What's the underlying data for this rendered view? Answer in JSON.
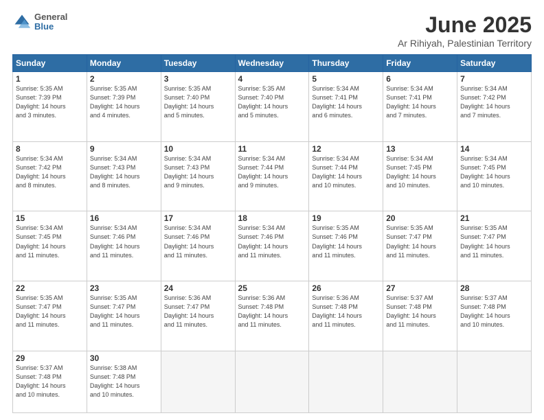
{
  "header": {
    "logo_general": "General",
    "logo_blue": "Blue",
    "title": "June 2025",
    "location": "Ar Rihiyah, Palestinian Territory"
  },
  "weekdays": [
    "Sunday",
    "Monday",
    "Tuesday",
    "Wednesday",
    "Thursday",
    "Friday",
    "Saturday"
  ],
  "weeks": [
    [
      {
        "day": "1",
        "info": "Sunrise: 5:35 AM\nSunset: 7:39 PM\nDaylight: 14 hours\nand 3 minutes."
      },
      {
        "day": "2",
        "info": "Sunrise: 5:35 AM\nSunset: 7:39 PM\nDaylight: 14 hours\nand 4 minutes."
      },
      {
        "day": "3",
        "info": "Sunrise: 5:35 AM\nSunset: 7:40 PM\nDaylight: 14 hours\nand 5 minutes."
      },
      {
        "day": "4",
        "info": "Sunrise: 5:35 AM\nSunset: 7:40 PM\nDaylight: 14 hours\nand 5 minutes."
      },
      {
        "day": "5",
        "info": "Sunrise: 5:34 AM\nSunset: 7:41 PM\nDaylight: 14 hours\nand 6 minutes."
      },
      {
        "day": "6",
        "info": "Sunrise: 5:34 AM\nSunset: 7:41 PM\nDaylight: 14 hours\nand 7 minutes."
      },
      {
        "day": "7",
        "info": "Sunrise: 5:34 AM\nSunset: 7:42 PM\nDaylight: 14 hours\nand 7 minutes."
      }
    ],
    [
      {
        "day": "8",
        "info": "Sunrise: 5:34 AM\nSunset: 7:42 PM\nDaylight: 14 hours\nand 8 minutes."
      },
      {
        "day": "9",
        "info": "Sunrise: 5:34 AM\nSunset: 7:43 PM\nDaylight: 14 hours\nand 8 minutes."
      },
      {
        "day": "10",
        "info": "Sunrise: 5:34 AM\nSunset: 7:43 PM\nDaylight: 14 hours\nand 9 minutes."
      },
      {
        "day": "11",
        "info": "Sunrise: 5:34 AM\nSunset: 7:44 PM\nDaylight: 14 hours\nand 9 minutes."
      },
      {
        "day": "12",
        "info": "Sunrise: 5:34 AM\nSunset: 7:44 PM\nDaylight: 14 hours\nand 10 minutes."
      },
      {
        "day": "13",
        "info": "Sunrise: 5:34 AM\nSunset: 7:45 PM\nDaylight: 14 hours\nand 10 minutes."
      },
      {
        "day": "14",
        "info": "Sunrise: 5:34 AM\nSunset: 7:45 PM\nDaylight: 14 hours\nand 10 minutes."
      }
    ],
    [
      {
        "day": "15",
        "info": "Sunrise: 5:34 AM\nSunset: 7:45 PM\nDaylight: 14 hours\nand 11 minutes."
      },
      {
        "day": "16",
        "info": "Sunrise: 5:34 AM\nSunset: 7:46 PM\nDaylight: 14 hours\nand 11 minutes."
      },
      {
        "day": "17",
        "info": "Sunrise: 5:34 AM\nSunset: 7:46 PM\nDaylight: 14 hours\nand 11 minutes."
      },
      {
        "day": "18",
        "info": "Sunrise: 5:34 AM\nSunset: 7:46 PM\nDaylight: 14 hours\nand 11 minutes."
      },
      {
        "day": "19",
        "info": "Sunrise: 5:35 AM\nSunset: 7:46 PM\nDaylight: 14 hours\nand 11 minutes."
      },
      {
        "day": "20",
        "info": "Sunrise: 5:35 AM\nSunset: 7:47 PM\nDaylight: 14 hours\nand 11 minutes."
      },
      {
        "day": "21",
        "info": "Sunrise: 5:35 AM\nSunset: 7:47 PM\nDaylight: 14 hours\nand 11 minutes."
      }
    ],
    [
      {
        "day": "22",
        "info": "Sunrise: 5:35 AM\nSunset: 7:47 PM\nDaylight: 14 hours\nand 11 minutes."
      },
      {
        "day": "23",
        "info": "Sunrise: 5:35 AM\nSunset: 7:47 PM\nDaylight: 14 hours\nand 11 minutes."
      },
      {
        "day": "24",
        "info": "Sunrise: 5:36 AM\nSunset: 7:47 PM\nDaylight: 14 hours\nand 11 minutes."
      },
      {
        "day": "25",
        "info": "Sunrise: 5:36 AM\nSunset: 7:48 PM\nDaylight: 14 hours\nand 11 minutes."
      },
      {
        "day": "26",
        "info": "Sunrise: 5:36 AM\nSunset: 7:48 PM\nDaylight: 14 hours\nand 11 minutes."
      },
      {
        "day": "27",
        "info": "Sunrise: 5:37 AM\nSunset: 7:48 PM\nDaylight: 14 hours\nand 11 minutes."
      },
      {
        "day": "28",
        "info": "Sunrise: 5:37 AM\nSunset: 7:48 PM\nDaylight: 14 hours\nand 10 minutes."
      }
    ],
    [
      {
        "day": "29",
        "info": "Sunrise: 5:37 AM\nSunset: 7:48 PM\nDaylight: 14 hours\nand 10 minutes."
      },
      {
        "day": "30",
        "info": "Sunrise: 5:38 AM\nSunset: 7:48 PM\nDaylight: 14 hours\nand 10 minutes."
      },
      {
        "day": "",
        "info": ""
      },
      {
        "day": "",
        "info": ""
      },
      {
        "day": "",
        "info": ""
      },
      {
        "day": "",
        "info": ""
      },
      {
        "day": "",
        "info": ""
      }
    ]
  ]
}
